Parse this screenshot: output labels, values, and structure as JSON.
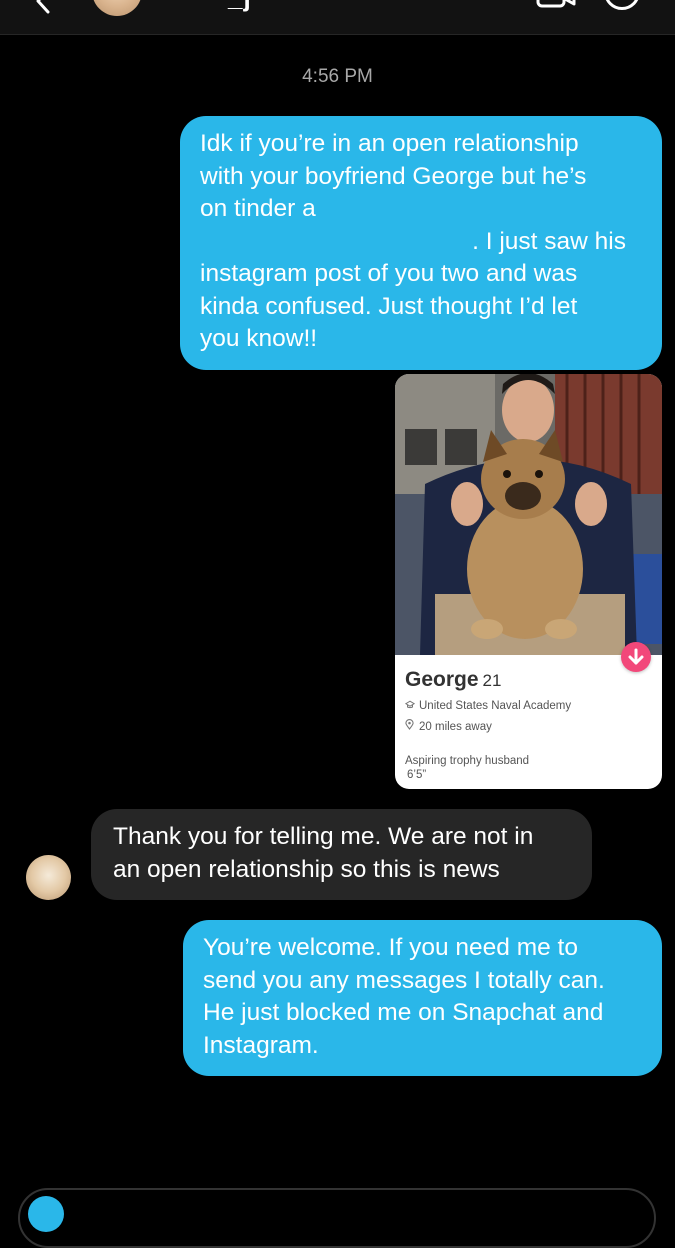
{
  "header": {
    "contact_name": "_j"
  },
  "thread": {
    "timestamp": "4:56 PM",
    "messages": [
      {
        "direction": "sent",
        "lines": [
          "Idk if you’re in an open relationship",
          "with your boyfriend George but he’s",
          "on tinder a",
          ". I just saw his",
          "instagram post of you two and was",
          "kinda confused. Just thought I’d let",
          "you know!!"
        ]
      },
      {
        "direction": "received",
        "lines": [
          "Thank you for telling me. We are not in",
          "an open relationship so this is news"
        ]
      },
      {
        "direction": "sent",
        "lines": [
          "You’re welcome. If you need me to",
          "send you any messages I totally can.",
          "He just blocked me on Snapchat and",
          "Instagram."
        ]
      }
    ]
  },
  "profile_card": {
    "name": "George",
    "age": "21",
    "school": "United States Naval Academy",
    "distance": "20 miles away",
    "bio_line1": "Aspiring trophy husband",
    "bio_line2": "6’5”"
  },
  "colors": {
    "sent_bubble": "#2ab7e9",
    "received_bubble": "#262626",
    "background": "#000000",
    "tinder_accent": "#f2487a"
  },
  "icons": {
    "back": "chevron-left-icon",
    "video": "video-camera-icon",
    "info": "info-icon",
    "school": "graduation-cap-icon",
    "location": "location-pin-icon",
    "down": "arrow-down-icon"
  }
}
